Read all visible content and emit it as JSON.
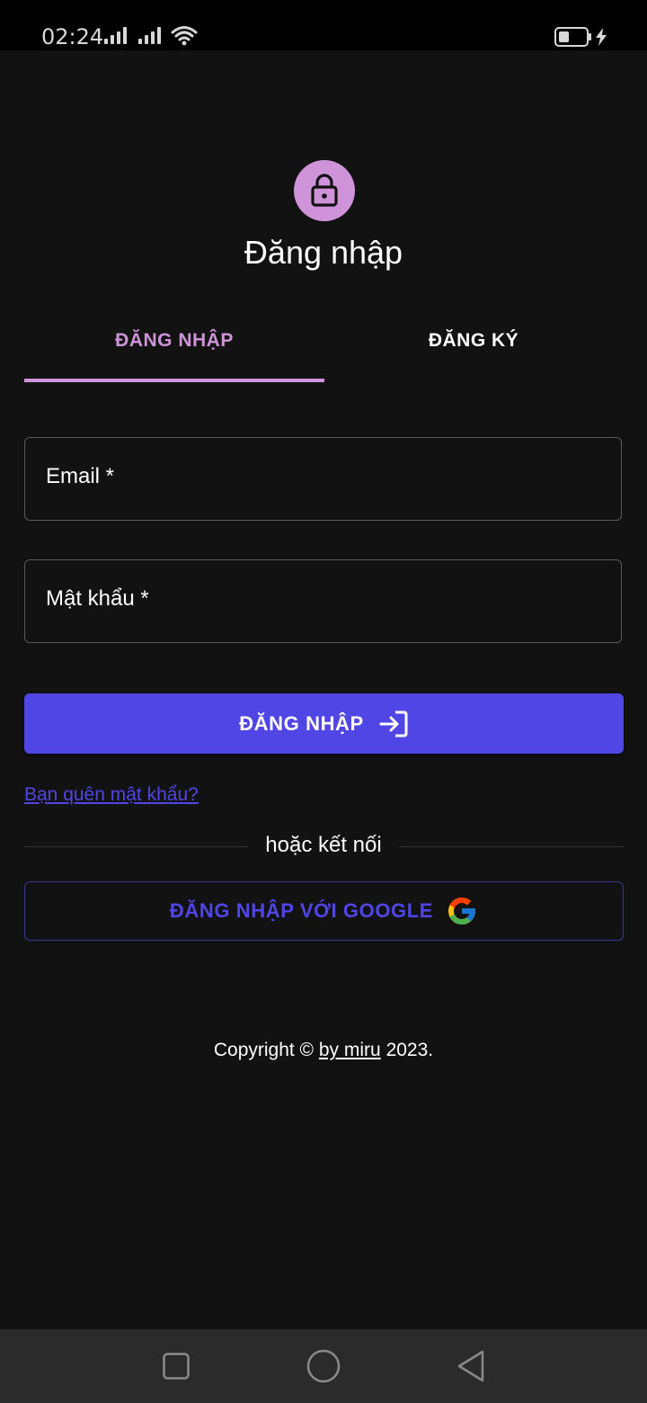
{
  "status_bar": {
    "time": "02:24"
  },
  "header": {
    "icon": "lock-icon",
    "title": "Đăng nhập"
  },
  "tabs": [
    {
      "label": "ĐĂNG NHẬP",
      "active": true
    },
    {
      "label": "ĐĂNG KÝ",
      "active": false
    }
  ],
  "form": {
    "email_label": "Email *",
    "password_label": "Mật khẩu *",
    "email_value": "",
    "password_value": "",
    "submit_label": "ĐĂNG NHẬP",
    "submit_icon": "login-icon",
    "forgot_label": "Bạn quên mật khẩu?",
    "divider_label": "hoặc kết nối",
    "google_label": "ĐĂNG NHẬP VỚI GOOGLE",
    "google_icon": "google-icon"
  },
  "footer": {
    "prefix": "Copyright ©",
    "link": "by miru",
    "suffix": "2023."
  },
  "colors": {
    "background": "#121212",
    "accent": "#ce93d8",
    "primary": "#5046e5"
  },
  "nav": {
    "icons": [
      "recent-apps-icon",
      "home-icon",
      "back-icon"
    ]
  }
}
